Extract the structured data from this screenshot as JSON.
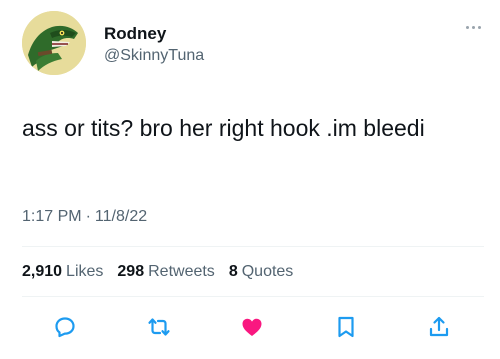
{
  "tweet": {
    "display_name": "Rodney",
    "handle": "@SkinnyTuna",
    "text": "ass or tits? bro her right hook .im bleedi",
    "time": "1:17 PM",
    "date": "11/8/22",
    "stats": {
      "likes_count": "2,910",
      "likes_label": "Likes",
      "retweets_count": "298",
      "retweets_label": "Retweets",
      "quotes_count": "8",
      "quotes_label": "Quotes"
    }
  },
  "colors": {
    "text_primary": "#0f1419",
    "text_secondary": "#536471",
    "like_active": "#f91880",
    "icon_blue": "#1d9bf0",
    "divider": "#eff3f4"
  },
  "icons": {
    "reply": "reply-icon",
    "retweet": "retweet-icon",
    "like": "heart-icon",
    "bookmark": "bookmark-icon",
    "share": "share-icon",
    "more": "more-icon"
  }
}
